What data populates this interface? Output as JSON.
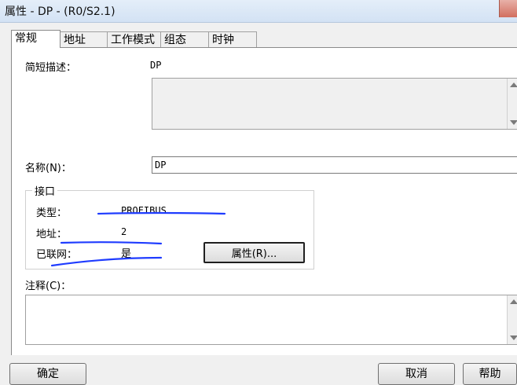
{
  "window": {
    "title": "属性 - DP - (R0/S2.1)"
  },
  "tabs": [
    {
      "label": "常规",
      "active": true
    },
    {
      "label": "地址"
    },
    {
      "label": "工作模式"
    },
    {
      "label": "组态"
    },
    {
      "label": "时钟"
    }
  ],
  "general": {
    "short_desc_label": "简短描述：",
    "short_desc_value": "DP",
    "name_label": "名称(N)：",
    "name_value": "DP",
    "comment_label": "注释(C)："
  },
  "interface": {
    "legend": "接口",
    "type_label": "类型：",
    "type_value": "PROFIBUS",
    "address_label": "地址：",
    "address_value": "2",
    "networked_label": "已联网：",
    "networked_value": "是",
    "properties_button": "属性(R)..."
  },
  "footer": {
    "ok_button": "确定",
    "cancel_button": "取消",
    "help_button": "帮助"
  },
  "colors": {
    "annotation_ink": "#1f3cff"
  }
}
